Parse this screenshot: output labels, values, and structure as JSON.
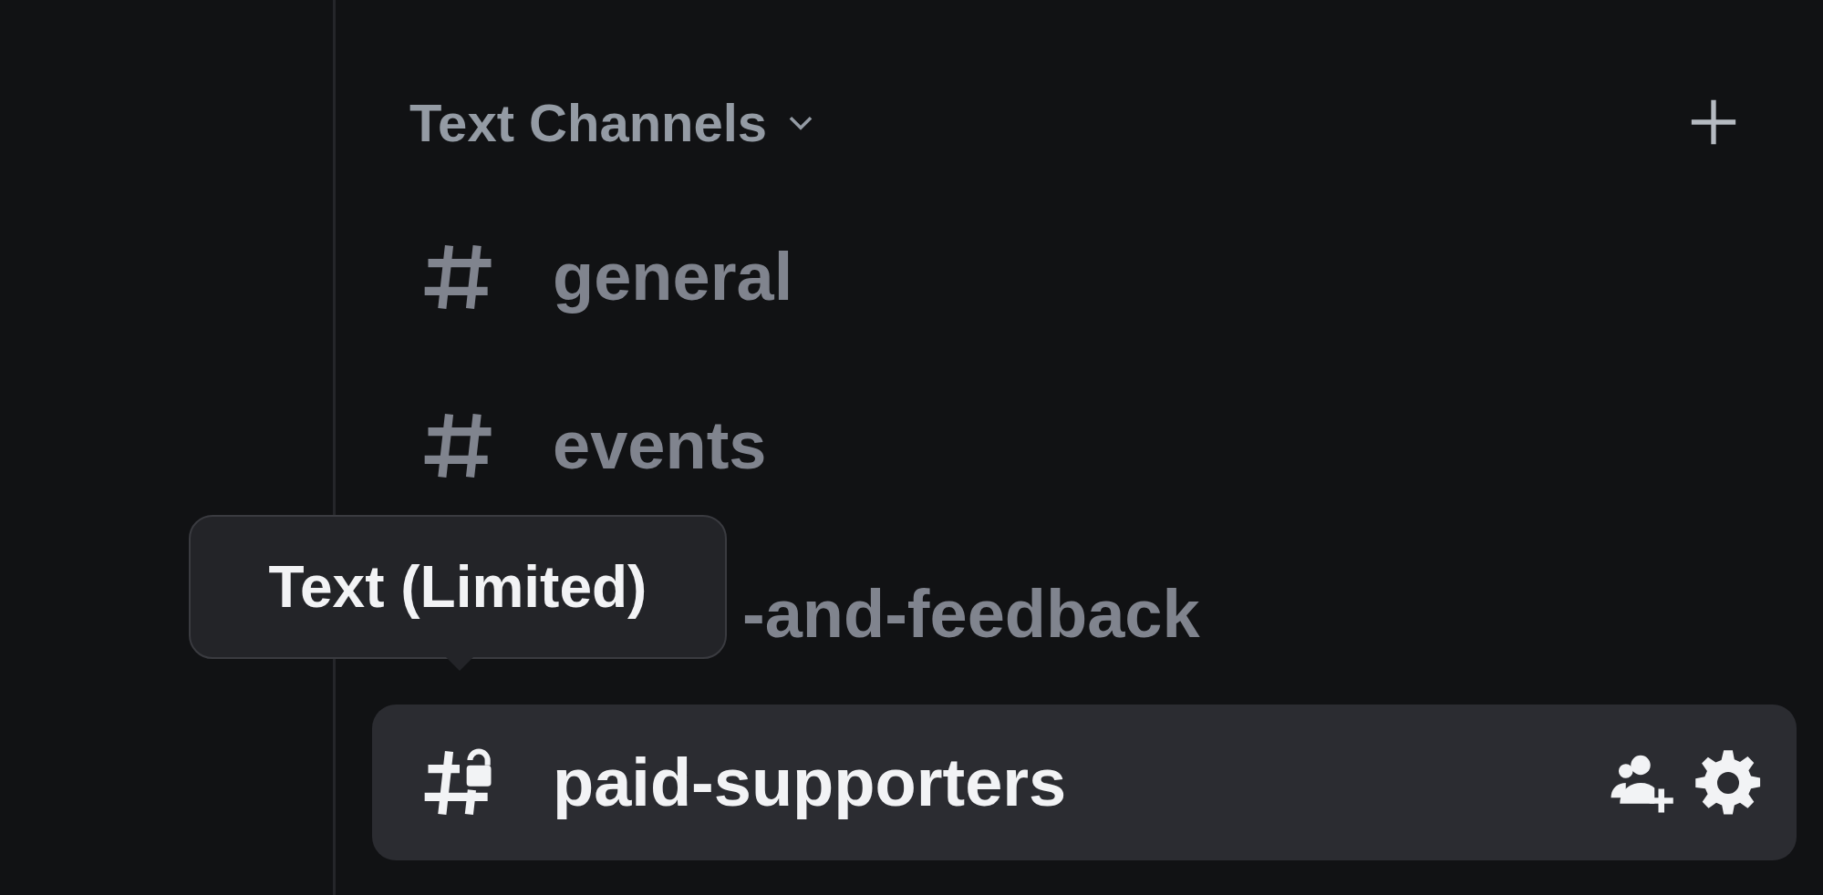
{
  "category": {
    "title": "Text Channels",
    "expanded": true
  },
  "channels": [
    {
      "name": "general",
      "kind": "text",
      "selected": false
    },
    {
      "name": "events",
      "kind": "text",
      "selected": false
    },
    {
      "name": "-and-feedback",
      "kind": "hidden",
      "selected": false
    },
    {
      "name": "paid-supporters",
      "kind": "locked",
      "selected": true
    }
  ],
  "tooltip": {
    "text": "Text (Limited)"
  }
}
